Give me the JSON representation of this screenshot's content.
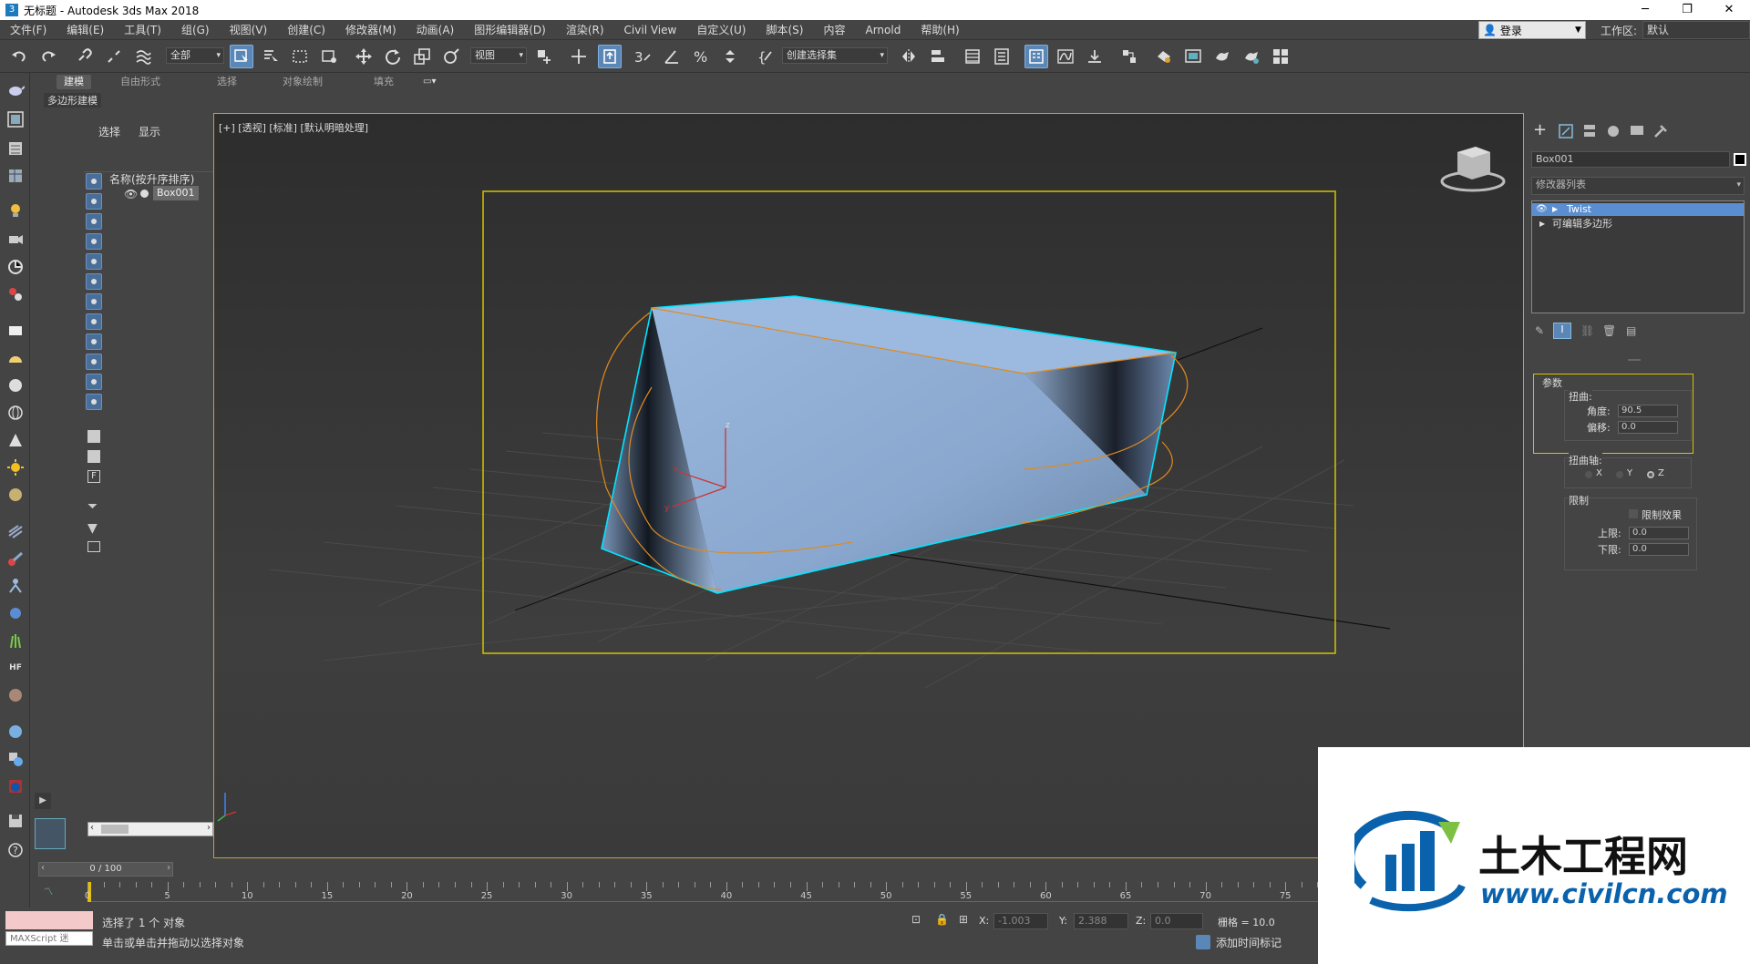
{
  "window": {
    "title": "无标题 - Autodesk 3ds Max 2018"
  },
  "menu": [
    "文件(F)",
    "编辑(E)",
    "工具(T)",
    "组(G)",
    "视图(V)",
    "创建(C)",
    "修改器(M)",
    "动画(A)",
    "图形编辑器(D)",
    "渲染(R)",
    "Civil View",
    "自定义(U)",
    "脚本(S)",
    "内容",
    "Arnold",
    "帮助(H)"
  ],
  "account": {
    "login": "登录",
    "workspace_label": "工作区:",
    "workspace_value": "默认"
  },
  "toolbar": {
    "filter": "全部",
    "coord_system": "视图",
    "selection_set": "创建选择集"
  },
  "ribbon": {
    "tabs": [
      "建模",
      "自由形式",
      "选择",
      "对象绘制",
      "填充"
    ],
    "sub_label": "多边形建模"
  },
  "scene_explorer": {
    "tabs": [
      "选择",
      "显示"
    ],
    "header": "名称(按升序排序)",
    "items": [
      "Box001"
    ]
  },
  "viewport": {
    "label": "[+] [透视] [标准] [默认明暗处理]"
  },
  "command_panel": {
    "object_name": "Box001",
    "modifier_list": "修改器列表",
    "stack": [
      "Twist",
      "可编辑多边形"
    ],
    "params": {
      "rollout": "参数",
      "twist_group": "扭曲:",
      "angle_label": "角度:",
      "angle_value": "90.5",
      "bias_label": "偏移:",
      "bias_value": "0.0",
      "axis_group": "扭曲轴:",
      "axes": [
        "X",
        "Y",
        "Z"
      ],
      "axis_selected": "Z",
      "limit_group": "限制",
      "limit_effect": "限制效果",
      "upper_label": "上限:",
      "upper_value": "0.0",
      "lower_label": "下限:",
      "lower_value": "0.0"
    }
  },
  "timeline": {
    "frame": "0 / 100",
    "ticks": [
      "0",
      "5",
      "10",
      "15",
      "20",
      "25",
      "30",
      "35",
      "40",
      "45",
      "50",
      "55",
      "60",
      "65",
      "70",
      "75"
    ]
  },
  "status": {
    "maxscript": "MAXScript 迷",
    "line1": "选择了 1 个 对象",
    "line2": "单击或单击并拖动以选择对象",
    "x_label": "X:",
    "x_value": "-1.003",
    "y_label": "Y:",
    "y_value": "2.388",
    "z_label": "Z:",
    "z_value": "0.0",
    "grid": "栅格 = 10.0",
    "add_time_tag": "添加时间标记"
  },
  "watermark": {
    "cn": "土木工程网",
    "url": "www.civilcn.com"
  },
  "colors": {
    "selection": "#00e5ff",
    "bbox": "#d6c200",
    "gizmo": "#e08a1e",
    "panel": "#444444",
    "active": "#5b87b7"
  }
}
